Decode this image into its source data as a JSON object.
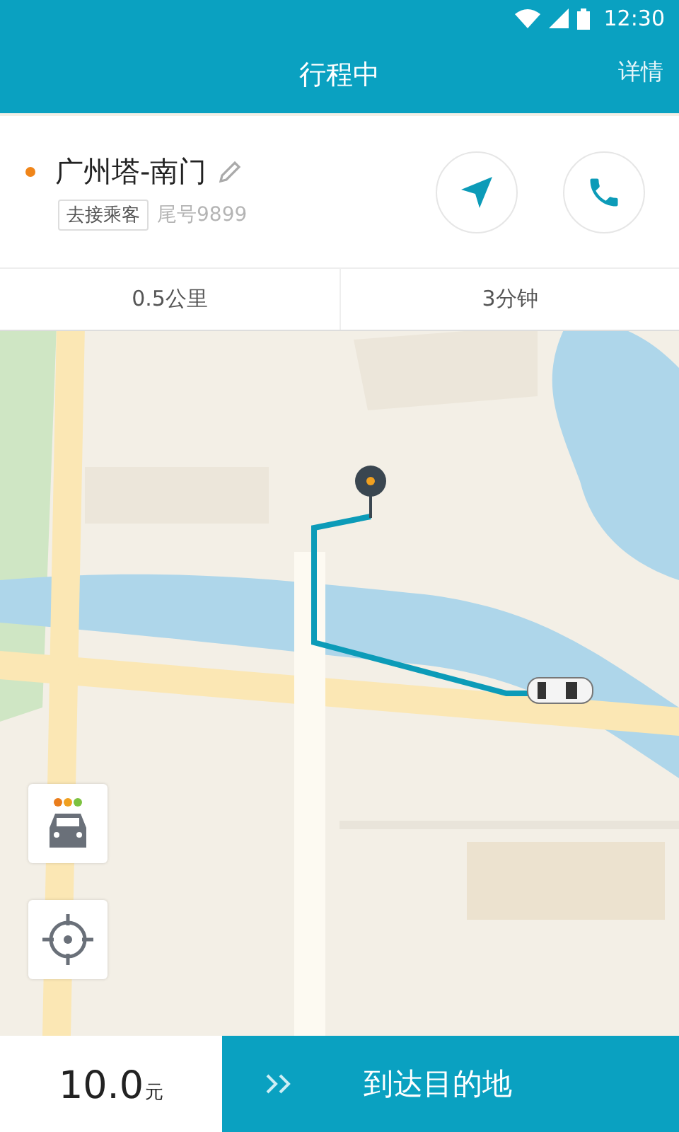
{
  "status_bar": {
    "time": "12:30"
  },
  "header": {
    "title": "行程中",
    "action": "详情"
  },
  "trip_card": {
    "destination": "广州塔-南门",
    "status_tag": "去接乘客",
    "passenger": "尾号9899",
    "distance": "0.5公里",
    "duration": "3分钟"
  },
  "bottom_bar": {
    "price": "10.0",
    "unit": "元",
    "action": "到达目的地"
  }
}
